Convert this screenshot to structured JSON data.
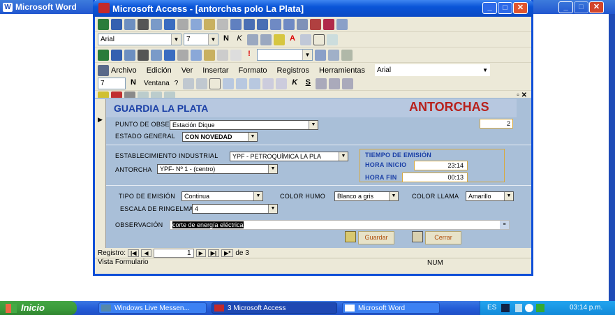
{
  "word": {
    "title": "Microsoft Word",
    "icon_letter": "W"
  },
  "access": {
    "title": "Microsoft Access - [antorchas polo La Plata]",
    "toolbar_font": "Arial",
    "toolbar_size": "7",
    "menu": [
      "Archivo",
      "Edición",
      "Ver",
      "Insertar",
      "Formato",
      "Registros",
      "Herramientas"
    ],
    "menu_font_box": "Arial",
    "row4_font": "7",
    "row4_ventana": "Ventana",
    "row4_help": "?"
  },
  "form": {
    "header_left": "GUARDIA LA PLATA",
    "header_right": "ANTORCHAS",
    "punto_label": "PUNTO DE OBSERVACIÓN",
    "punto_value": "Estación Dique",
    "record_id": "2",
    "estado_label": "ESTADO GENERAL",
    "estado_value": "CON NOVEDAD",
    "establecimiento_label": "ESTABLECIMIENTO INDUSTRIAL",
    "establecimiento_value": "YPF - PETROQUÍMICA LA PLA",
    "antorcha_label": "ANTORCHA",
    "antorcha_value": "YPF- Nº 1 - (centro)",
    "tiempo_label": "TIEMPO DE EMISIÓN",
    "hora_inicio_label": "HORA INICIO",
    "hora_inicio_value": "23:14",
    "hora_fin_label": "HORA FIN",
    "hora_fin_value": "00:13",
    "tipo_label": "TIPO DE EMISIÓN",
    "tipo_value": "Continua",
    "color_humo_label": "COLOR HUMO",
    "color_humo_value": "Blanco a gris",
    "color_llama_label": "COLOR LLAMA",
    "color_llama_value": "Amarillo",
    "escala_label": "ESCALA DE RINGELMANN",
    "escala_value": "4",
    "observacion_label": "OBSERVACIÓN",
    "observacion_value": "corte de energía eléctrica",
    "guardar_label": "Guardar",
    "cerrar_label": "Cerrar"
  },
  "nav": {
    "label": "Registro:",
    "current": "1",
    "of_label": "de 3"
  },
  "status": {
    "left": "Vista Formulario",
    "num": "NUM"
  },
  "taskbar": {
    "start": "Inicio",
    "tasks": [
      "Windows Live Messen...",
      "3 Microsoft Access",
      "Microsoft Word"
    ],
    "lang": "ES",
    "time": "03:14 p.m."
  },
  "colors": {
    "header_red": "#b8211c",
    "header_blue": "#1a3fa6",
    "title_blue": "#0a55d8",
    "form_bg": "#a9bfd8"
  }
}
